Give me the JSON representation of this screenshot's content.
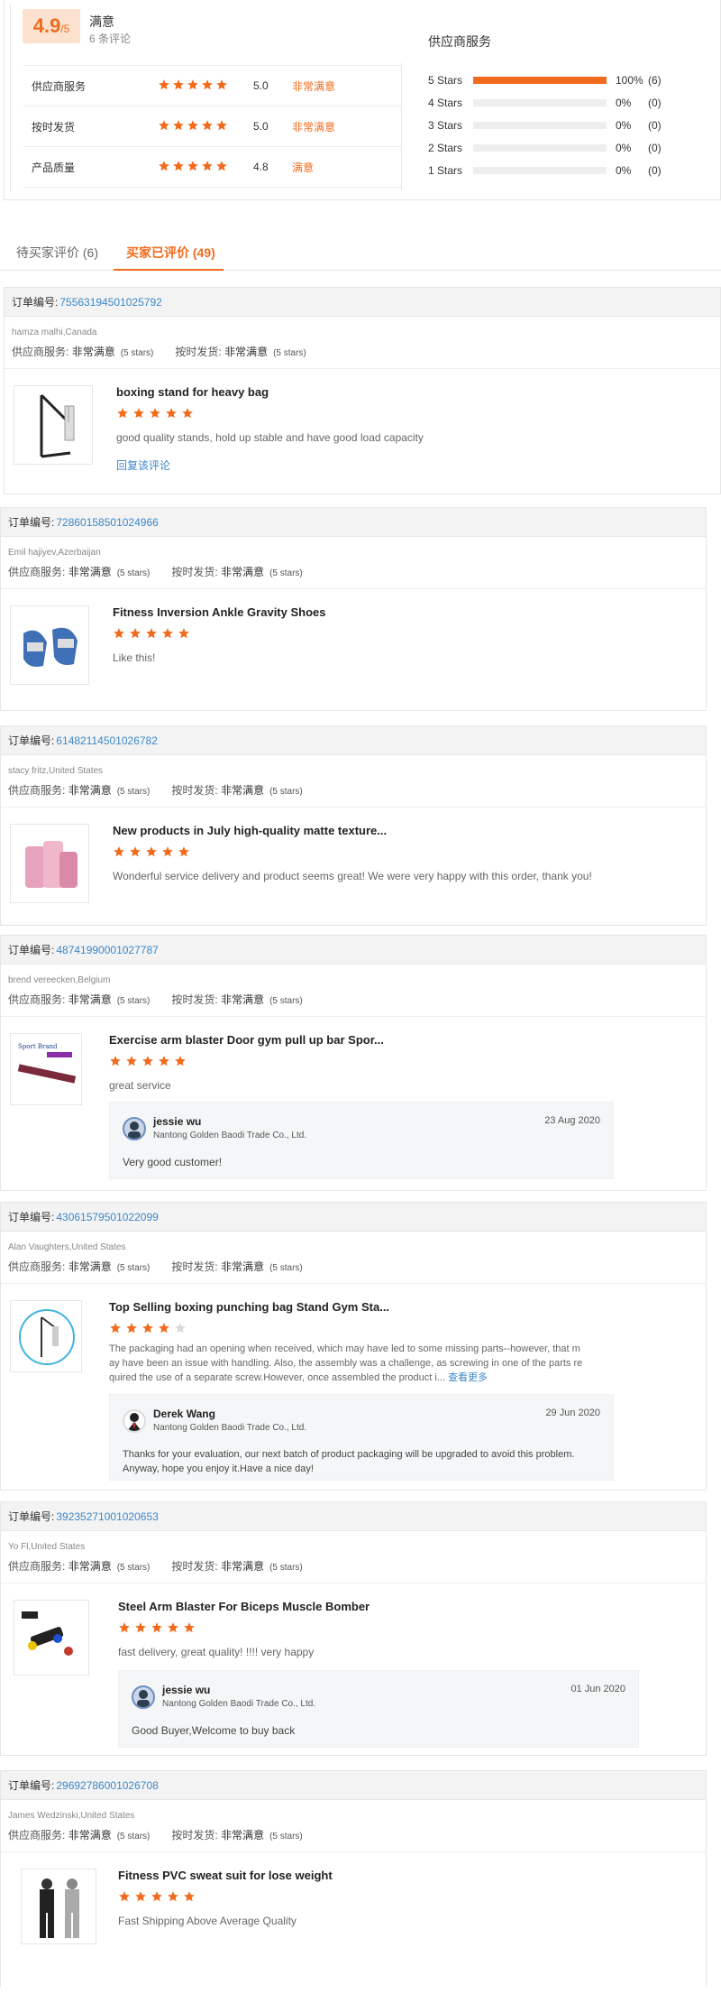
{
  "summary": {
    "score": "4.9",
    "score_of": "/5",
    "satisfaction": "满意",
    "review_count": "6 条评论",
    "metrics": [
      {
        "label": "供应商服务",
        "score": "5.0",
        "level": "非常满意",
        "stars": 5
      },
      {
        "label": "按时发货",
        "score": "5.0",
        "level": "非常满意",
        "stars": 5
      },
      {
        "label": "产品质量",
        "score": "4.8",
        "level": "满意",
        "stars": 5
      }
    ],
    "distribution_title": "供应商服务",
    "distribution": [
      {
        "label": "5 Stars",
        "pct": "100%",
        "count": "(6)",
        "fraction": 1.0
      },
      {
        "label": "4 Stars",
        "pct": "0%",
        "count": "(0)",
        "fraction": 0
      },
      {
        "label": "3 Stars",
        "pct": "0%",
        "count": "(0)",
        "fraction": 0
      },
      {
        "label": "2 Stars",
        "pct": "0%",
        "count": "(0)",
        "fraction": 0
      },
      {
        "label": "1 Stars",
        "pct": "0%",
        "count": "(0)",
        "fraction": 0
      }
    ]
  },
  "tabs": [
    {
      "label": "待买家评价 (6)"
    },
    {
      "label": "买家已评价 (49)"
    }
  ],
  "labels": {
    "order_no": "订单编号:",
    "supplier_service": "供应商服务:",
    "on_time": "按时发货:",
    "reply": "回复该评论",
    "more": "查看更多"
  },
  "reviews": [
    {
      "order": "75563194501025792",
      "buyer": "hamza malhi,Canada",
      "service": "非常满意",
      "service_sub": "(5 stars)",
      "ship": "非常满意",
      "ship_sub": "(5 stars)",
      "title": "boxing stand for heavy bag",
      "stars": 5,
      "text": "good quality stands, hold up stable and have good load capacity"
    },
    {
      "order": "72860158501024966",
      "buyer": "Emil hajiyev,Azerbaijan",
      "service": "非常满意",
      "service_sub": "(5 stars)",
      "ship": "非常满意",
      "ship_sub": "(5 stars)",
      "title": "Fitness Inversion Ankle Gravity Shoes",
      "stars": 5,
      "text": "Like this!"
    },
    {
      "order": "61482114501026782",
      "buyer": "stacy fritz,United States",
      "service": "非常满意",
      "service_sub": "(5 stars)",
      "ship": "非常满意",
      "ship_sub": "(5 stars)",
      "title": "New products in July high-quality matte texture...",
      "stars": 5,
      "text": "Wonderful service delivery and product seems great! We were very happy with this order, thank you!"
    },
    {
      "order": "48741990001027787",
      "buyer": "brend vereecken,Belgium",
      "service": "非常满意",
      "service_sub": "(5 stars)",
      "ship": "非常满意",
      "ship_sub": "(5 stars)",
      "title": "Exercise arm blaster Door gym pull up bar Spor...",
      "stars": 5,
      "text": "great service",
      "reply": {
        "name": "jessie wu",
        "company": "Nantong Golden Baodi Trade Co., Ltd.",
        "date": "23 Aug 2020",
        "msg": "Very good customer!"
      }
    },
    {
      "order": "43061579501022099",
      "buyer": "Alan Vaughters,United States",
      "service": "非常满意",
      "service_sub": "(5 stars)",
      "ship": "非常满意",
      "ship_sub": "(5 stars)",
      "title": "Top Selling boxing punching bag Stand Gym Sta...",
      "stars": 4,
      "text_lines": [
        "The packaging had an opening when received, which may have led to some missing parts--however, that m",
        "ay have been an issue with handling. Also, the assembly was a challenge, as screwing in one of the parts re",
        "quired the use of a separate screw.However, once assembled the product i..."
      ],
      "reply": {
        "name": "Derek Wang",
        "company": "Nantong Golden Baodi Trade Co., Ltd.",
        "date": "29 Jun 2020",
        "msg_lines": [
          "Thanks for your evaluation, our next batch of product packaging will  be upgraded to avoid this problem.",
          "Anyway, hope you enjoy it.Have a nice day!"
        ]
      }
    },
    {
      "order": "39235271001020653",
      "buyer": "Yo Fl,United States",
      "service": "非常满意",
      "service_sub": "(5 stars)",
      "ship": "非常满意",
      "ship_sub": "(5 stars)",
      "title": "Steel Arm Blaster For Biceps Muscle Bomber",
      "stars": 5,
      "text": "fast delivery, great quality! !!!! very happy",
      "reply": {
        "name": "jessie wu",
        "company": "Nantong Golden Baodi Trade Co., Ltd.",
        "date": "01 Jun 2020",
        "msg": "Good Buyer,Welcome to buy back"
      }
    },
    {
      "order": "29692786001026708",
      "buyer": "James Wedzinski,United States",
      "service": "非常满意",
      "service_sub": "(5 stars)",
      "ship": "非常满意",
      "ship_sub": "(5 stars)",
      "title": "Fitness PVC sweat suit for lose weight",
      "stars": 5,
      "text": "Fast Shipping Above Average Quality"
    }
  ],
  "colors": {
    "accent": "#f26b1d",
    "link": "#3d87c8",
    "star_empty": "#d9d9d9"
  }
}
